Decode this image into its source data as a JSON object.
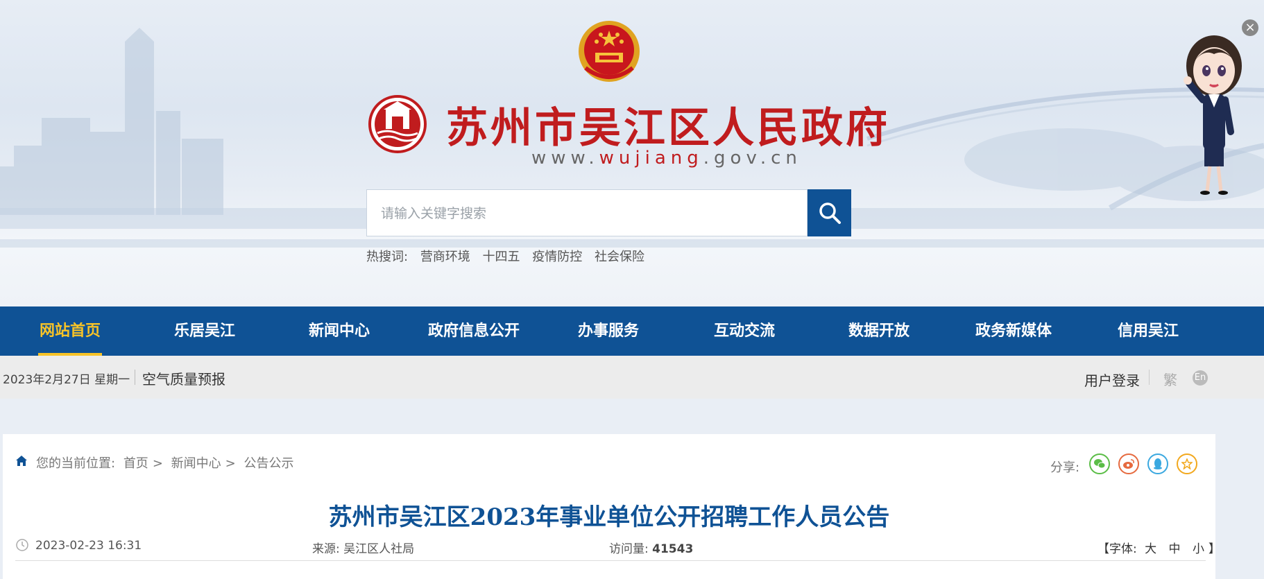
{
  "header": {
    "site_title": "苏州市吴江区人民政府",
    "url_prefix": "www.",
    "url_highlight": "wujiang",
    "url_suffix": ".gov.cn",
    "search_placeholder": "请输入关键字搜索",
    "hot_label": "热搜词:",
    "hot_words": [
      "营商环境",
      "十四五",
      "疫情防控",
      "社会保险"
    ],
    "close_label": "×"
  },
  "nav": {
    "items": [
      {
        "label": "网站首页",
        "active": true
      },
      {
        "label": "乐居吴江"
      },
      {
        "label": "新闻中心"
      },
      {
        "label": "政府信息公开"
      },
      {
        "label": "办事服务"
      },
      {
        "label": "互动交流"
      },
      {
        "label": "数据开放"
      },
      {
        "label": "政务新媒体"
      },
      {
        "label": "信用吴江"
      }
    ]
  },
  "infobar": {
    "date": "2023年2月27日 星期一",
    "air_quality": "空气质量预报",
    "login": "用户登录",
    "traditional": "繁",
    "english": "En"
  },
  "breadcrumb": {
    "label": "您的当前位置:",
    "items": [
      "首页",
      "新闻中心",
      "公告公示"
    ],
    "sep": ">"
  },
  "share": {
    "label": "分享:",
    "icons": [
      "wechat-icon",
      "weibo-icon",
      "qq-icon",
      "favorite-icon"
    ]
  },
  "article": {
    "title": "苏州市吴江区2023年事业单位公开招聘工作人员公告",
    "datetime": "2023-02-23 16:31",
    "source_label": "来源:",
    "source": "吴江区人社局",
    "views_label": "访问量:",
    "views": "41543",
    "font_label": "【字体:",
    "font_large": "大",
    "font_medium": "中",
    "font_small": "小",
    "font_close": "】"
  },
  "colors": {
    "brand_blue": "#0f5295",
    "title_red": "#c01c1e",
    "active_gold": "#f7c327"
  }
}
